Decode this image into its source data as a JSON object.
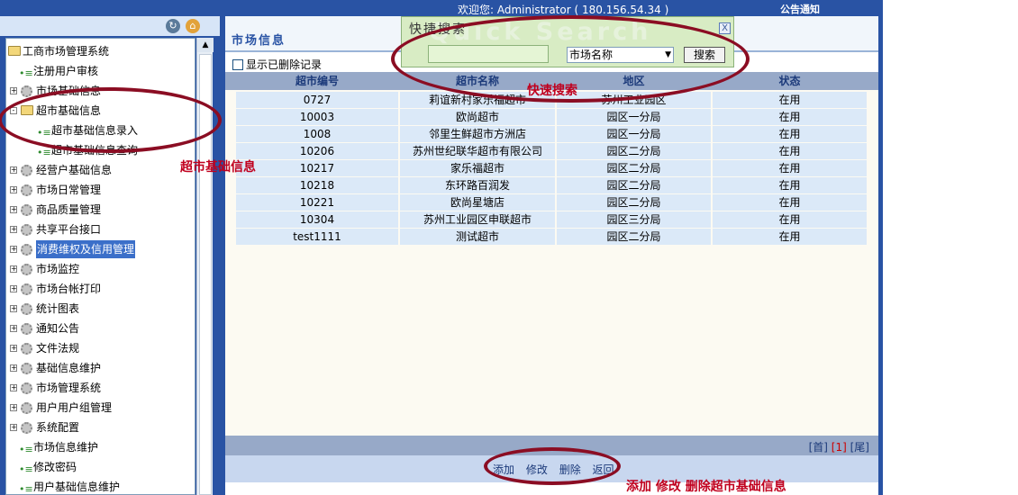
{
  "topbar": {
    "welcome": "欢迎您: Administrator ( 180.156.54.34 )",
    "notice": "公告通知"
  },
  "left_toolbar": {
    "refresh_icon": "refresh-icon",
    "home_icon": "home-icon"
  },
  "tree": [
    {
      "label": "工商市场管理系统",
      "type": "root"
    },
    {
      "label": "注册用户审核",
      "type": "leaf"
    },
    {
      "label": "市场基础信息",
      "type": "folder"
    },
    {
      "label": "超市基础信息",
      "type": "folder-open"
    },
    {
      "label": "超市基础信息录入",
      "type": "subleaf"
    },
    {
      "label": "超市基础信息查询",
      "type": "subleaf"
    },
    {
      "label": "经营户基础信息",
      "type": "folder"
    },
    {
      "label": "市场日常管理",
      "type": "folder"
    },
    {
      "label": "商品质量管理",
      "type": "folder"
    },
    {
      "label": "共享平台接口",
      "type": "folder"
    },
    {
      "label": "消费维权及信用管理",
      "type": "folder",
      "selected": true
    },
    {
      "label": "市场监控",
      "type": "folder"
    },
    {
      "label": "市场台帐打印",
      "type": "folder"
    },
    {
      "label": "统计图表",
      "type": "folder"
    },
    {
      "label": "通知公告",
      "type": "folder"
    },
    {
      "label": "文件法规",
      "type": "folder"
    },
    {
      "label": "基础信息维护",
      "type": "folder"
    },
    {
      "label": "市场管理系统",
      "type": "folder"
    },
    {
      "label": "用户用户组管理",
      "type": "folder"
    },
    {
      "label": "系统配置",
      "type": "folder"
    },
    {
      "label": "市场信息维护",
      "type": "leaf"
    },
    {
      "label": "修改密码",
      "type": "leaf"
    },
    {
      "label": "用户基础信息维护",
      "type": "leaf"
    }
  ],
  "main": {
    "title": "市场信息",
    "show_deleted": "显示已删除记录",
    "columns": [
      "超市编号",
      "超市名称",
      "地区",
      "状态"
    ],
    "rows": [
      [
        "0727",
        "莉谊新村家乐福超市",
        "苏州工业园区",
        "在用"
      ],
      [
        "10003",
        "欧尚超市",
        "园区一分局",
        "在用"
      ],
      [
        "1008",
        "邻里生鲜超市方洲店",
        "园区一分局",
        "在用"
      ],
      [
        "10206",
        "苏州世纪联华超市有限公司",
        "园区二分局",
        "在用"
      ],
      [
        "10217",
        "家乐福超市",
        "园区二分局",
        "在用"
      ],
      [
        "10218",
        "东环路百润发",
        "园区二分局",
        "在用"
      ],
      [
        "10221",
        "欧尚星塘店",
        "园区二分局",
        "在用"
      ],
      [
        "10304",
        "苏州工业园区申联超市",
        "园区三分局",
        "在用"
      ],
      [
        "test1111",
        "测试超市",
        "园区二分局",
        "在用"
      ]
    ],
    "pager": {
      "first": "[首]",
      "current": "[1]",
      "last": "[尾]"
    },
    "actions": [
      "添加",
      "修改",
      "删除",
      "返回"
    ]
  },
  "quick_search": {
    "title": "快捷搜索",
    "watermark": "Quick Search",
    "input_value": "",
    "select_value": "市场名称",
    "button": "搜索",
    "close": "X"
  },
  "annotations": {
    "quick_search": "快速搜索",
    "supermarket_info": "超市基础信息",
    "crud": "添加 修改 删除超市基础信息"
  },
  "colors": {
    "frame_blue": "#2953a4",
    "annotation_red": "#c0001e",
    "annotation_ring": "#8b0d23"
  }
}
